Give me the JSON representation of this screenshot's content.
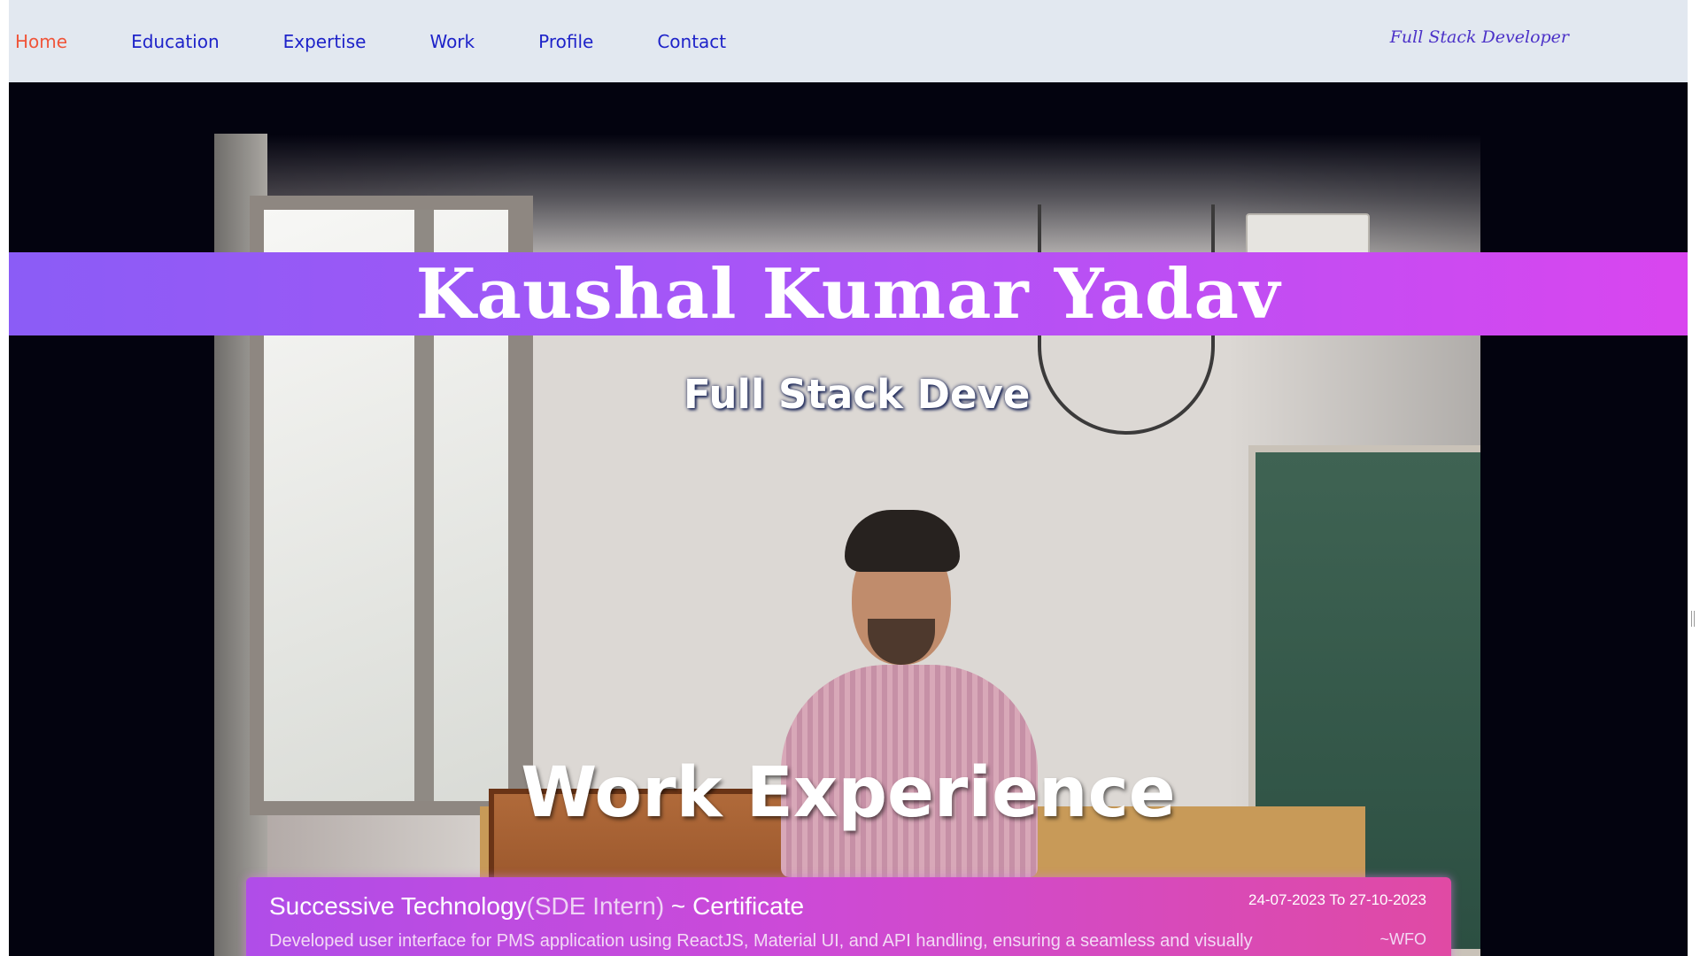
{
  "nav": {
    "links": [
      {
        "label": "Home",
        "active": true
      },
      {
        "label": "Education",
        "active": false
      },
      {
        "label": "Expertise",
        "active": false
      },
      {
        "label": "Work",
        "active": false
      },
      {
        "label": "Profile",
        "active": false
      },
      {
        "label": "Contact",
        "active": false
      }
    ],
    "tagline": "Full Stack Developer"
  },
  "hero": {
    "name": "Kaushal Kumar Yadav",
    "typed_role": "Full Stack Deve"
  },
  "work": {
    "heading": "Work Experience",
    "items": [
      {
        "company": "Successive Technology",
        "role": "(SDE Intern)",
        "suffix": " ~ Certificate",
        "dates": "24-07-2023 To 27-10-2023",
        "description": "Developed user interface for PMS application using ReactJS, Material UI, and API handling, ensuring a seamless and visually",
        "mode": "~WFO"
      }
    ]
  },
  "colors": {
    "nav_bg": "#e2e8f0",
    "nav_link": "#1e23c9",
    "nav_active": "#f0553a",
    "band_start": "#8b5cf6",
    "band_end": "#d946ef",
    "card_start": "#b04de8",
    "card_end": "#e04aa4"
  }
}
